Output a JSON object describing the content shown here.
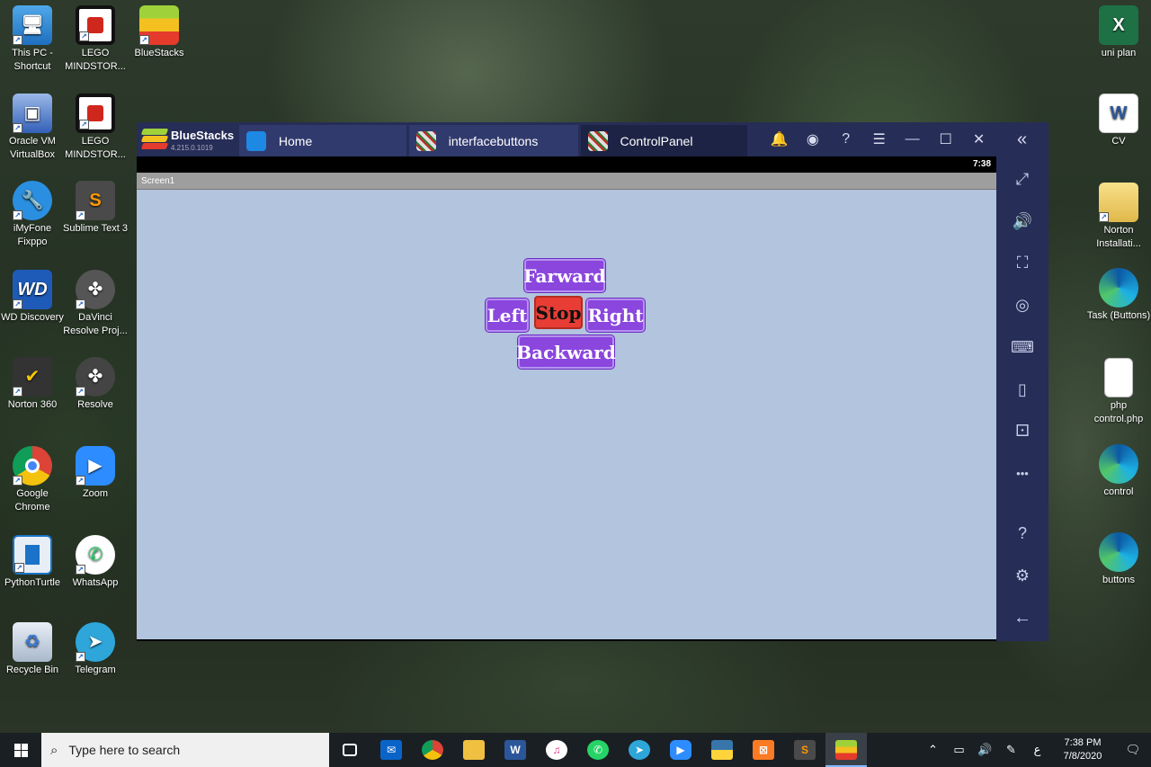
{
  "desktop": {
    "left_icons": [
      {
        "label": "This PC - Shortcut",
        "icon": "computer-icon"
      },
      {
        "label": "LEGO MINDSTOR...",
        "icon": "lego-mindstorms-icon"
      },
      {
        "label": "BlueStacks",
        "icon": "bluestacks-icon"
      },
      {
        "label": "Oracle VM VirtualBox",
        "icon": "virtualbox-icon"
      },
      {
        "label": "LEGO MINDSTOR...",
        "icon": "lego-mindstorms-icon"
      },
      {
        "label": "iMyFone Fixppo",
        "icon": "imyfone-icon"
      },
      {
        "label": "Sublime Text 3",
        "icon": "sublime-icon"
      },
      {
        "label": "WD Discovery",
        "icon": "wd-icon"
      },
      {
        "label": "DaVinci Resolve Proj...",
        "icon": "davinci-icon"
      },
      {
        "label": "Norton 360",
        "icon": "norton-icon"
      },
      {
        "label": "Resolve",
        "icon": "resolve-icon"
      },
      {
        "label": "Google Chrome",
        "icon": "chrome-icon"
      },
      {
        "label": "Zoom",
        "icon": "zoom-icon"
      },
      {
        "label": "PythonTurtle",
        "icon": "python-turtle-icon"
      },
      {
        "label": "WhatsApp",
        "icon": "whatsapp-icon"
      },
      {
        "label": "Recycle Bin",
        "icon": "recycle-bin-icon"
      },
      {
        "label": "Telegram",
        "icon": "telegram-icon"
      }
    ],
    "right_icons": [
      {
        "label": "uni plan",
        "icon": "excel-icon"
      },
      {
        "label": "CV",
        "icon": "word-icon"
      },
      {
        "label": "Norton Installati...",
        "icon": "folder-icon"
      },
      {
        "label": "Task (Buttons)",
        "icon": "edge-icon"
      },
      {
        "label": "php control.php",
        "icon": "file-icon"
      },
      {
        "label": "control",
        "icon": "edge-icon"
      },
      {
        "label": "buttons",
        "icon": "edge-icon"
      }
    ]
  },
  "bluestacks": {
    "brand": "BlueStacks",
    "version": "4.215.0.1019",
    "tabs": [
      {
        "label": "Home"
      },
      {
        "label": "interfacebuttons"
      },
      {
        "label": "ControlPanel"
      }
    ],
    "controls": {
      "bell": "🔔",
      "account": "◉",
      "help": "?",
      "menu": "☰",
      "minimize": "—",
      "maximize": "☐",
      "close": "✕",
      "collapse": "«"
    },
    "sidebar": [
      "⤢",
      "🔊",
      "⛶",
      "◎",
      "⌨",
      "▯",
      "⚀",
      "•••",
      "?",
      "⚙",
      "←"
    ]
  },
  "android": {
    "time": "7:38",
    "screen_title": "Screen1",
    "buttons": {
      "forward": "Farward",
      "left": "Left",
      "stop": "Stop",
      "right": "Right",
      "backward": "Backward"
    }
  },
  "taskbar": {
    "search_placeholder": "Type here to search",
    "time": "7:38 PM",
    "date": "7/8/2020",
    "apps": [
      "task-view",
      "mail",
      "chrome",
      "file-explorer",
      "word",
      "itunes",
      "whatsapp",
      "telegram",
      "zoom",
      "python",
      "xampp",
      "sublime",
      "bluestacks"
    ]
  }
}
